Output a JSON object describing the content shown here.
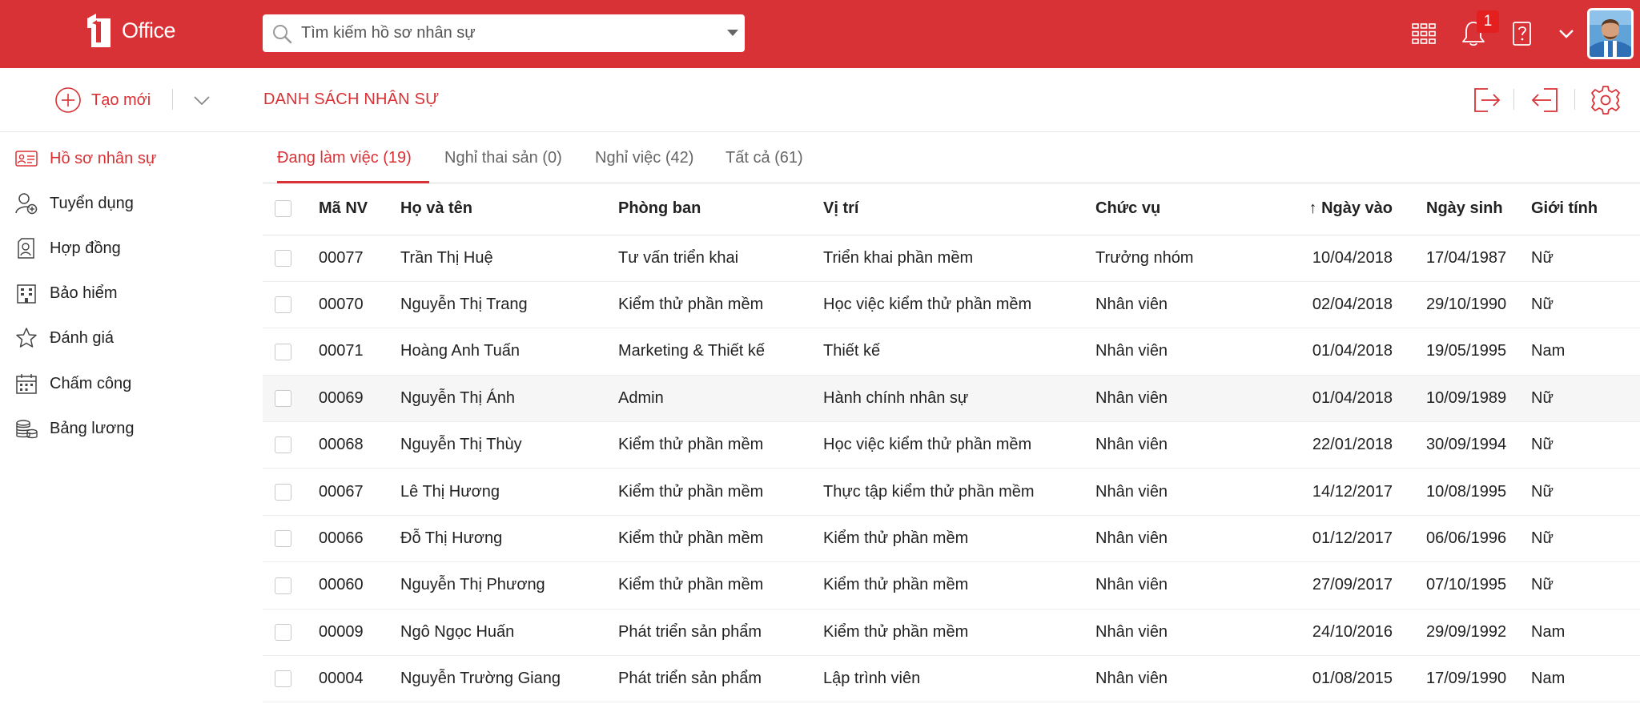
{
  "brand": {
    "logo_text": "Office",
    "accent": "#d93236"
  },
  "search": {
    "placeholder": "Tìm kiếm hồ sơ nhân sự"
  },
  "topbar": {
    "notification_count": "1",
    "icons": [
      "apps-grid-icon",
      "bell-icon",
      "help-book-icon",
      "chevron-down-icon",
      "avatar"
    ]
  },
  "toolbar": {
    "new_label": "Tạo mới",
    "title": "DANH SÁCH NHÂN SỰ",
    "icons": [
      "export-icon",
      "import-icon",
      "settings-icon"
    ]
  },
  "sidebar": {
    "items": [
      {
        "label": "Hồ sơ nhân sự",
        "icon": "id-card-icon",
        "active": true
      },
      {
        "label": "Tuyển dụng",
        "icon": "user-add-icon"
      },
      {
        "label": "Hợp đồng",
        "icon": "contract-icon"
      },
      {
        "label": "Bảo hiểm",
        "icon": "building-icon"
      },
      {
        "label": "Đánh giá",
        "icon": "star-icon"
      },
      {
        "label": "Chấm công",
        "icon": "calendar-icon"
      },
      {
        "label": "Bảng lương",
        "icon": "coins-icon"
      }
    ]
  },
  "tabs": [
    {
      "label": "Đang làm việc (19)",
      "active": true
    },
    {
      "label": "Nghỉ thai sản (0)"
    },
    {
      "label": "Nghỉ việc (42)"
    },
    {
      "label": "Tất cả (61)"
    }
  ],
  "table": {
    "headers": [
      "Mã NV",
      "Họ và tên",
      "Phòng ban",
      "Vị trí",
      "Chức vụ",
      "Ngày vào",
      "Ngày sinh",
      "Giới tính"
    ],
    "sort_column": "Ngày vào",
    "sort_direction": "ascending-arrow",
    "rows": [
      [
        "00077",
        "Trần Thị Huệ",
        "Tư vấn triển khai",
        "Triển khai phần mềm",
        "Trưởng nhóm",
        "10/04/2018",
        "17/04/1987",
        "Nữ"
      ],
      [
        "00070",
        "Nguyễn Thị Trang",
        "Kiểm thử phần mềm",
        "Học việc kiểm thử phần mềm",
        "Nhân viên",
        "02/04/2018",
        "29/10/1990",
        "Nữ"
      ],
      [
        "00071",
        "Hoàng Anh Tuấn",
        "Marketing & Thiết kế",
        "Thiết kế",
        "Nhân viên",
        "01/04/2018",
        "19/05/1995",
        "Nam"
      ],
      [
        "00069",
        "Nguyễn Thị Ánh",
        "Admin",
        "Hành chính nhân sự",
        "Nhân viên",
        "01/04/2018",
        "10/09/1989",
        "Nữ"
      ],
      [
        "00068",
        "Nguyễn Thị Thùy",
        "Kiểm thử phần mềm",
        "Học việc kiểm thử phần mềm",
        "Nhân viên",
        "22/01/2018",
        "30/09/1994",
        "Nữ"
      ],
      [
        "00067",
        "Lê Thị Hương",
        "Kiểm thử phần mềm",
        "Thực tập kiểm thử phần mềm",
        "Nhân viên",
        "14/12/2017",
        "10/08/1995",
        "Nữ"
      ],
      [
        "00066",
        "Đỗ Thị Hương",
        "Kiểm thử phần mềm",
        "Kiểm thử phần mềm",
        "Nhân viên",
        "01/12/2017",
        "06/06/1996",
        "Nữ"
      ],
      [
        "00060",
        "Nguyễn Thị Phương",
        "Kiểm thử phần mềm",
        "Kiểm thử phần mềm",
        "Nhân viên",
        "27/09/2017",
        "07/10/1995",
        "Nữ"
      ],
      [
        "00009",
        "Ngô Ngọc Huấn",
        "Phát triển sản phẩm",
        "Kiểm thử phần mềm",
        "Nhân viên",
        "24/10/2016",
        "29/09/1992",
        "Nam"
      ],
      [
        "00004",
        "Nguyễn Trường Giang",
        "Phát triển sản phẩm",
        "Lập trình viên",
        "Nhân viên",
        "01/08/2015",
        "17/09/1990",
        "Nam"
      ]
    ]
  }
}
